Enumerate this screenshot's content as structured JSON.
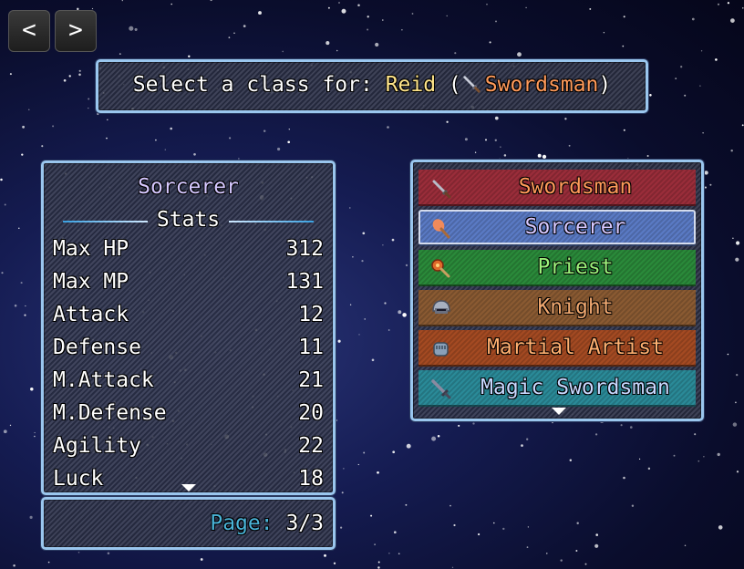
{
  "nav": {
    "prev_label": "<",
    "next_label": ">"
  },
  "header": {
    "prefix": "Select a class for: ",
    "actor": "Reid",
    "open_paren": " (",
    "class_name": "Swordsman",
    "close_paren": ")",
    "class_icon": "sword-icon"
  },
  "status": {
    "class_name": "Sorcerer",
    "section_title": "Stats",
    "stats": [
      {
        "name": "Max HP",
        "value": "312"
      },
      {
        "name": "Max MP",
        "value": "131"
      },
      {
        "name": "Attack",
        "value": "12"
      },
      {
        "name": "Defense",
        "value": "11"
      },
      {
        "name": "M.Attack",
        "value": "21"
      },
      {
        "name": "M.Defense",
        "value": "20"
      },
      {
        "name": "Agility",
        "value": "22"
      },
      {
        "name": "Luck",
        "value": "18"
      }
    ]
  },
  "page": {
    "label": "Page:",
    "value": "3/3"
  },
  "class_list": {
    "selected_index": 1,
    "items": [
      {
        "label": "Swordsman",
        "icon": "sword-icon",
        "bg": "#9a2d3a",
        "text_color": "#ff9a5a"
      },
      {
        "label": "Sorcerer",
        "icon": "staff-icon",
        "bg": "#5a7ac4",
        "text_color": "#d6c8ff"
      },
      {
        "label": "Priest",
        "icon": "mace-icon",
        "bg": "#2a8a3a",
        "text_color": "#9cf07a"
      },
      {
        "label": "Knight",
        "icon": "helmet-icon",
        "bg": "#8a5a32",
        "text_color": "#f0a870"
      },
      {
        "label": "Martial Artist",
        "icon": "fist-icon",
        "bg": "#a44a22",
        "text_color": "#ffb070"
      },
      {
        "label": "Magic Swordsman",
        "icon": "rune-sword-icon",
        "bg": "#2a8a98",
        "text_color": "#c8d8ff"
      }
    ]
  },
  "colors": {
    "header_actor": "#ffe58a",
    "header_class": "#ff9a5a",
    "class_title": "#d6c8ff",
    "page_label": "#4ab4d8",
    "window_border": "#9ac6ee"
  }
}
